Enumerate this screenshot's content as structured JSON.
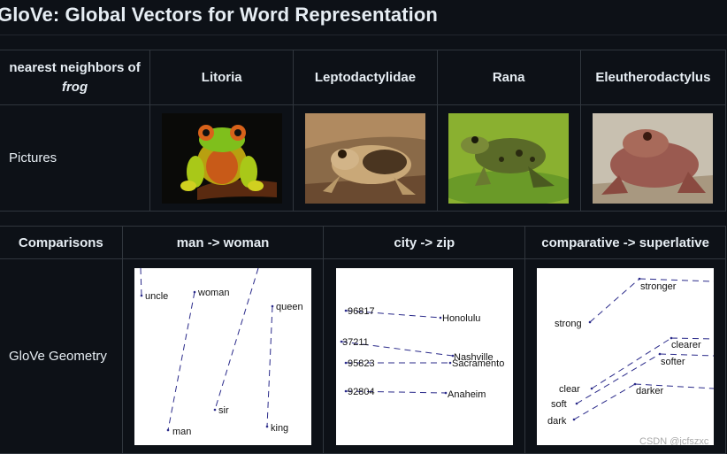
{
  "title": "GloVe: Global Vectors for Word Representation",
  "neighbors_table": {
    "header_label": "nearest neighbors of",
    "header_word": "frog",
    "columns": [
      "Litoria",
      "Leptodactylidae",
      "Rana",
      "Eleutherodactylus"
    ],
    "row_label": "Pictures"
  },
  "comparisons_table": {
    "header_label": "Comparisons",
    "columns": [
      "man -> woman",
      "city -> zip",
      "comparative -> superlative"
    ],
    "row_label": "GloVe Geometry",
    "plots": {
      "gender": [
        "uncle",
        "woman",
        "queen",
        "sir",
        "man",
        "king"
      ],
      "zip": [
        "96817",
        "Honolulu",
        "37211",
        "Nashville",
        "95823",
        "Sacramento",
        "92804",
        "Anaheim"
      ],
      "comparative": [
        "stronger",
        "strong",
        "clearer",
        "softer",
        "clear",
        "soft",
        "dark",
        "darker"
      ]
    },
    "watermark": "CSDN @jcfszxc"
  }
}
